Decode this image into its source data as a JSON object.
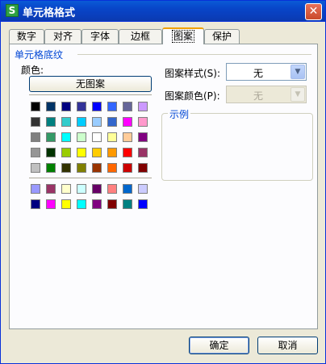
{
  "window": {
    "title": "单元格格式",
    "icon_char": "S",
    "close_char": "✕"
  },
  "tabs": [
    {
      "label": "数字",
      "active": false
    },
    {
      "label": "对齐",
      "active": false
    },
    {
      "label": "字体",
      "active": false
    },
    {
      "label": "边框",
      "active": false
    },
    {
      "label": "图案",
      "active": true
    },
    {
      "label": "保护",
      "active": false
    }
  ],
  "shading": {
    "group_title": "单元格底纹",
    "color_label": "颜色:",
    "no_pattern_button": "无图案",
    "palette_main": [
      [
        "#000000",
        "#003366",
        "#000080",
        "#333399",
        "#0000ff",
        "#3366ff",
        "#666699",
        "#cc99ff"
      ],
      [
        "#333333",
        "#008080",
        "#33cccc",
        "#00ccff",
        "#99ccff",
        "#3366cc",
        "#ff00ff",
        "#ff99cc"
      ],
      [
        "#808080",
        "#339966",
        "#00ffff",
        "#ccffcc",
        "#ffffff",
        "#ffff99",
        "#ffcc99",
        "#800080"
      ],
      [
        "#969696",
        "#003300",
        "#99cc00",
        "#ffff00",
        "#ffcc00",
        "#ff9900",
        "#ff0000",
        "#993366"
      ],
      [
        "#c0c0c0",
        "#008000",
        "#333300",
        "#808000",
        "#993300",
        "#ff6600",
        "#cc0000",
        "#800000"
      ]
    ],
    "palette_extra": [
      [
        "#9999ff",
        "#993366",
        "#ffffcc",
        "#ccffff",
        "#660066",
        "#ff8080",
        "#0066cc",
        "#ccccff"
      ],
      [
        "#000080",
        "#ff00ff",
        "#ffff00",
        "#00ffff",
        "#800080",
        "#800000",
        "#008080",
        "#0000ff"
      ]
    ]
  },
  "pattern": {
    "style_label": "图案样式(S):",
    "style_value": "无",
    "color_label": "图案颜色(P):",
    "color_value": "无",
    "sample_title": "示例"
  },
  "buttons": {
    "ok": "确定",
    "cancel": "取消"
  }
}
